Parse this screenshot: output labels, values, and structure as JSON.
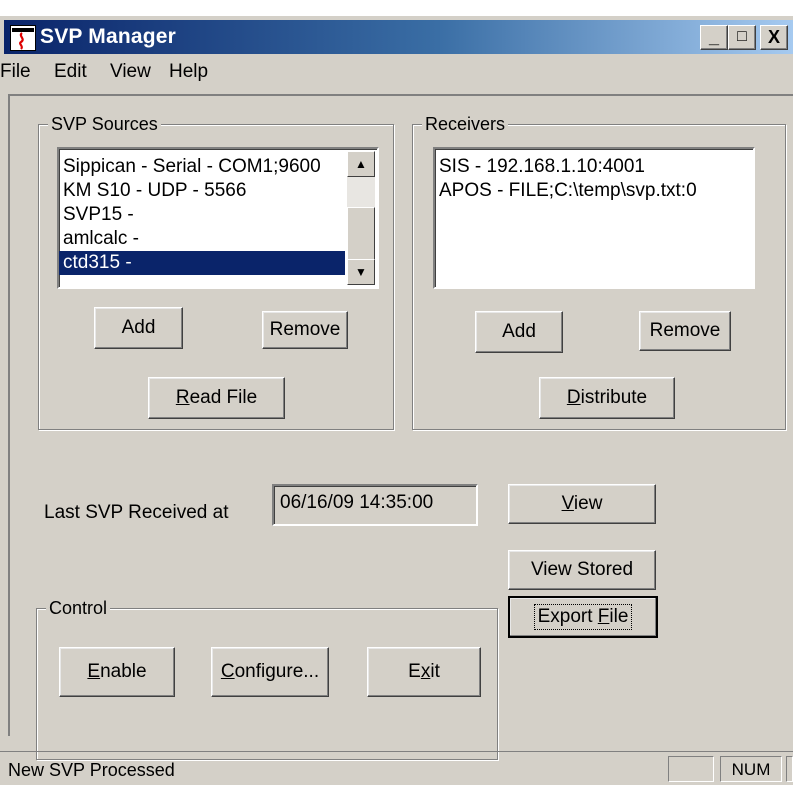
{
  "window": {
    "title": "SVP Manager",
    "controls": {
      "minimize": "_",
      "maximize": "□",
      "close": "X"
    }
  },
  "menu": [
    "File",
    "Edit",
    "View",
    "Help"
  ],
  "sources": {
    "title": "SVP Sources",
    "items": [
      "Sippican - Serial - COM1;9600",
      "KM S10 - UDP - 5566",
      "SVP15 -",
      "amlcalc -",
      "ctd315 -"
    ],
    "selected_index": 4,
    "add_label": "Add",
    "remove_label": "Remove",
    "read_file_label": "Read File"
  },
  "receivers": {
    "title": "Receivers",
    "items": [
      "SIS - 192.168.1.10:4001",
      "APOS - FILE;C:\\temp\\svp.txt:0"
    ],
    "add_label": "Add",
    "remove_label": "Remove",
    "distribute_label": "Distribute"
  },
  "last_svp": {
    "label": "Last SVP Received at",
    "value": "06/16/09 14:35:00"
  },
  "actions": {
    "view_label": "View",
    "view_stored_label": "View Stored",
    "export_file_label": "Export File"
  },
  "control": {
    "title": "Control",
    "enable_label": "Enable",
    "configure_label": "Configure...",
    "exit_label": "Exit"
  },
  "status": {
    "message": "New SVP Processed",
    "num": "NUM"
  },
  "colors": {
    "face": "#d4d0c8",
    "title_start": "#0a246a",
    "title_end": "#a6caf0",
    "selection": "#0a246a"
  }
}
